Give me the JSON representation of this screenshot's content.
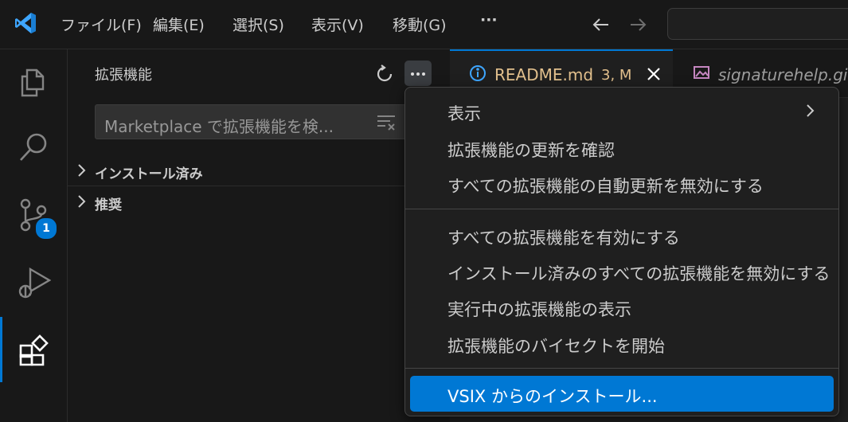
{
  "titlebar": {
    "menus": [
      "ファイル(F)",
      "編集(E)",
      "選択(S)",
      "表示(V)",
      "移動(G)",
      "···"
    ],
    "app_icon": "vscode-logo",
    "back_icon": "arrow-left-icon",
    "forward_icon": "arrow-right-icon"
  },
  "activitybar": {
    "items": [
      "explorer-icon",
      "search-icon",
      "source-control-icon",
      "run-debug-icon",
      "extensions-icon"
    ],
    "source_control_badge": "1",
    "active": "extensions"
  },
  "sidebar": {
    "title": "拡張機能",
    "search_placeholder": "Marketplace で拡張機能を検...",
    "sections": [
      {
        "label": "インストール済み"
      },
      {
        "label": "推奨"
      }
    ]
  },
  "tabs": [
    {
      "label": "README.md",
      "status": "3, M",
      "icon": "info-icon"
    },
    {
      "label": "signaturehelp.gif",
      "icon": "image-icon"
    }
  ],
  "context_menu": {
    "groups": [
      [
        "表示",
        "拡張機能の更新を確認",
        "すべての拡張機能の自動更新を無効にする"
      ],
      [
        "すべての拡張機能を有効にする",
        "インストール済みのすべての拡張機能を無効にする",
        "実行中の拡張機能の表示",
        "拡張機能のバイセクトを開始"
      ],
      [
        "VSIX からのインストール..."
      ]
    ],
    "highlighted": "VSIX からのインストール...",
    "submenu_item": "表示"
  },
  "colors": {
    "accent": "#0078d4",
    "background": "#181818",
    "modified_tab": "#e2c08d"
  }
}
